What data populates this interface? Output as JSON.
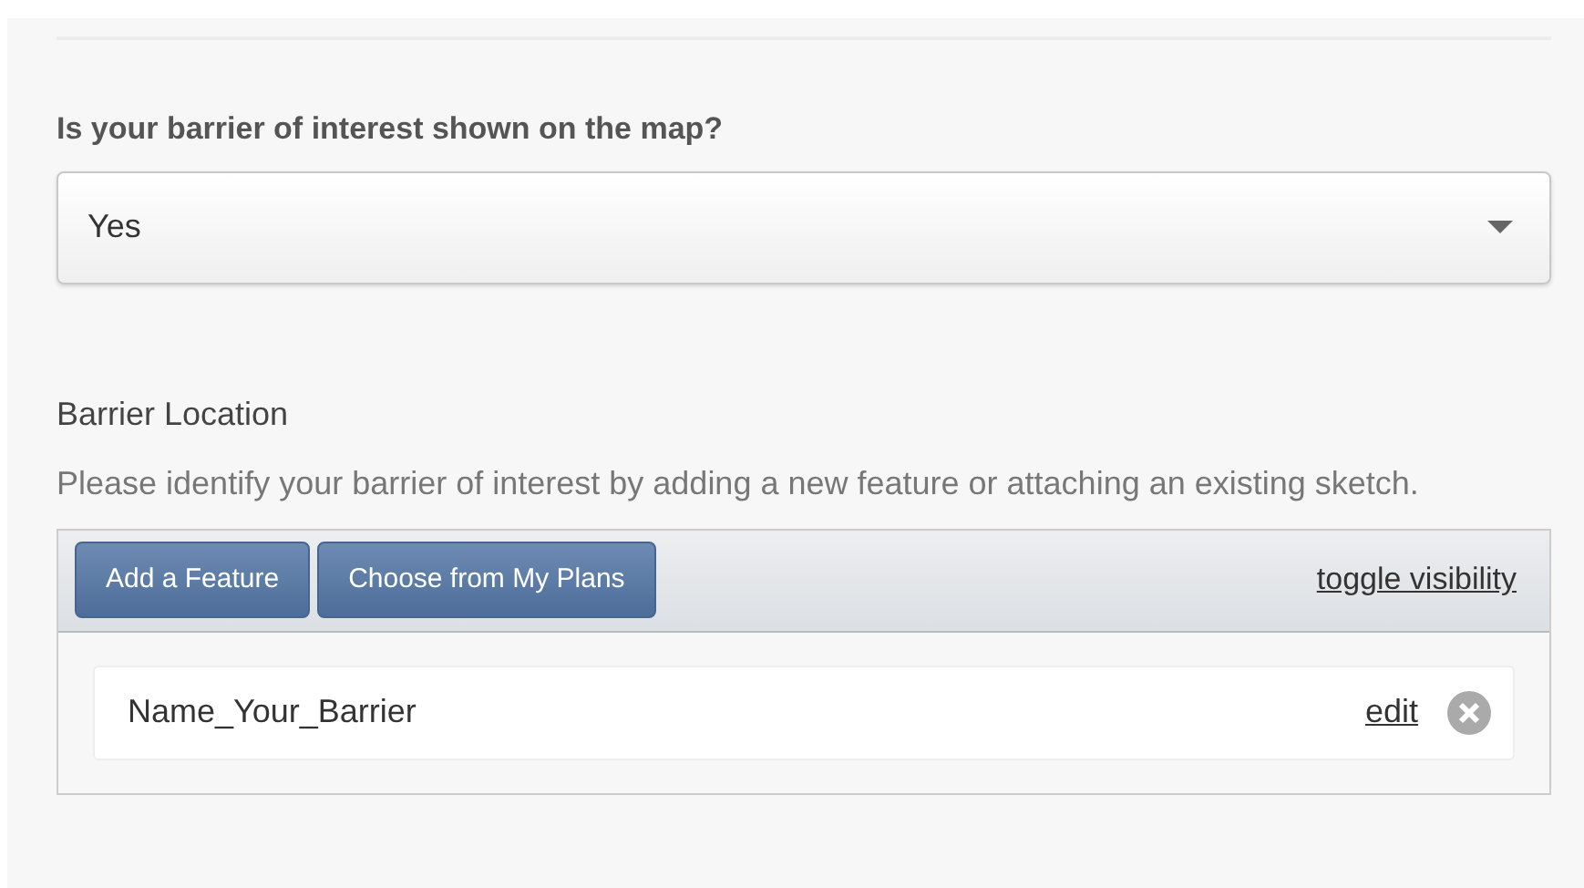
{
  "question": {
    "label": "Is your barrier of interest shown on the map?",
    "value": "Yes"
  },
  "location": {
    "heading": "Barrier Location",
    "description": "Please identify your barrier of interest by adding a new feature or attaching an existing sketch.",
    "buttons": [
      "Add a Feature",
      "Choose from My Plans"
    ],
    "toggle_link": "toggle visibility",
    "features": [
      {
        "name": "Name_Your_Barrier",
        "edit_link": "edit"
      }
    ]
  }
}
